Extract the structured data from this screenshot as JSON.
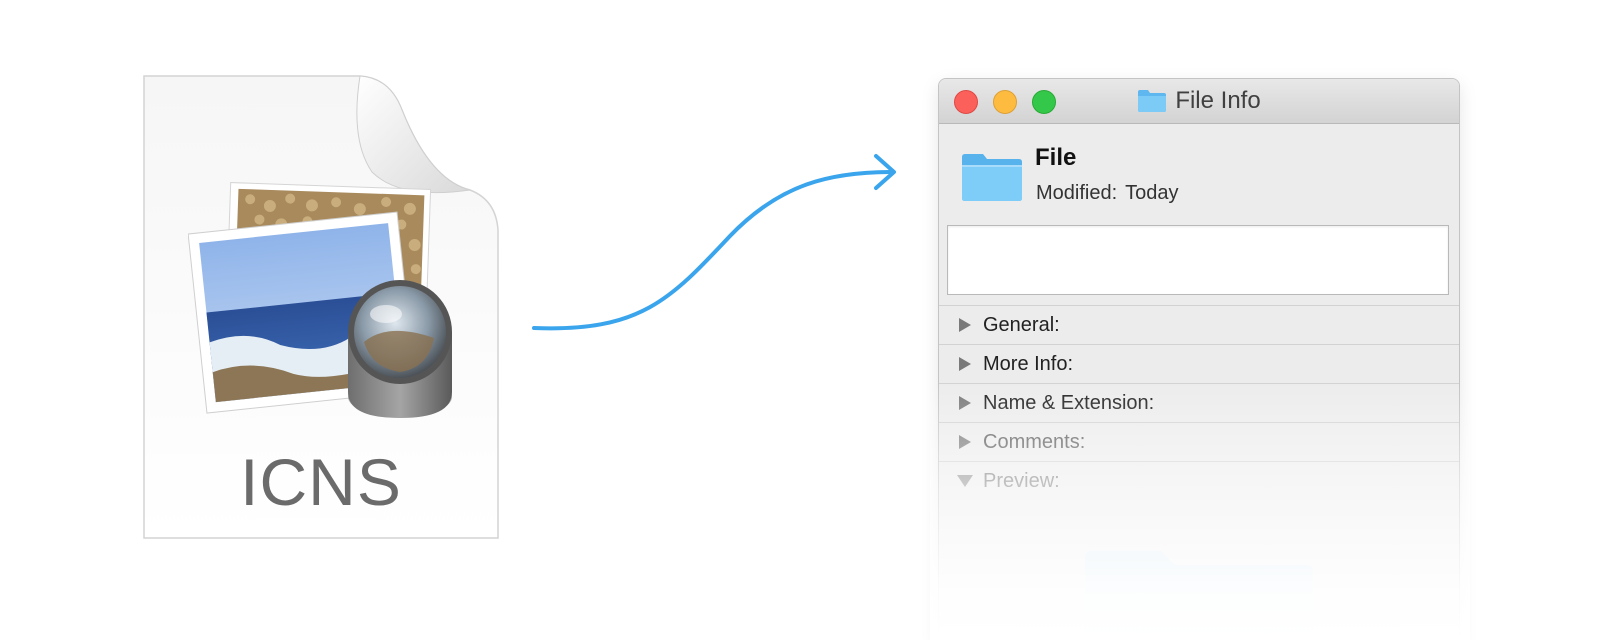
{
  "document_icon": {
    "label": "ICNS",
    "icon": "preview-document-icon"
  },
  "window": {
    "title": "File Info",
    "title_icon": "folder-icon",
    "file": {
      "name": "File",
      "modified_label": "Modified:",
      "modified_value": "Today",
      "icon": "folder-icon"
    },
    "sections": [
      {
        "label": "General:",
        "expanded": false
      },
      {
        "label": "More Info:",
        "expanded": false
      },
      {
        "label": "Name & Extension:",
        "expanded": false
      },
      {
        "label": "Comments:",
        "expanded": false
      },
      {
        "label": "Preview:",
        "expanded": true
      }
    ]
  },
  "colors": {
    "arrow": "#3aa5ec",
    "close": "#fc605b",
    "minimize": "#fdbc40",
    "zoom": "#34c84a",
    "folder": "#6cc4f5"
  }
}
